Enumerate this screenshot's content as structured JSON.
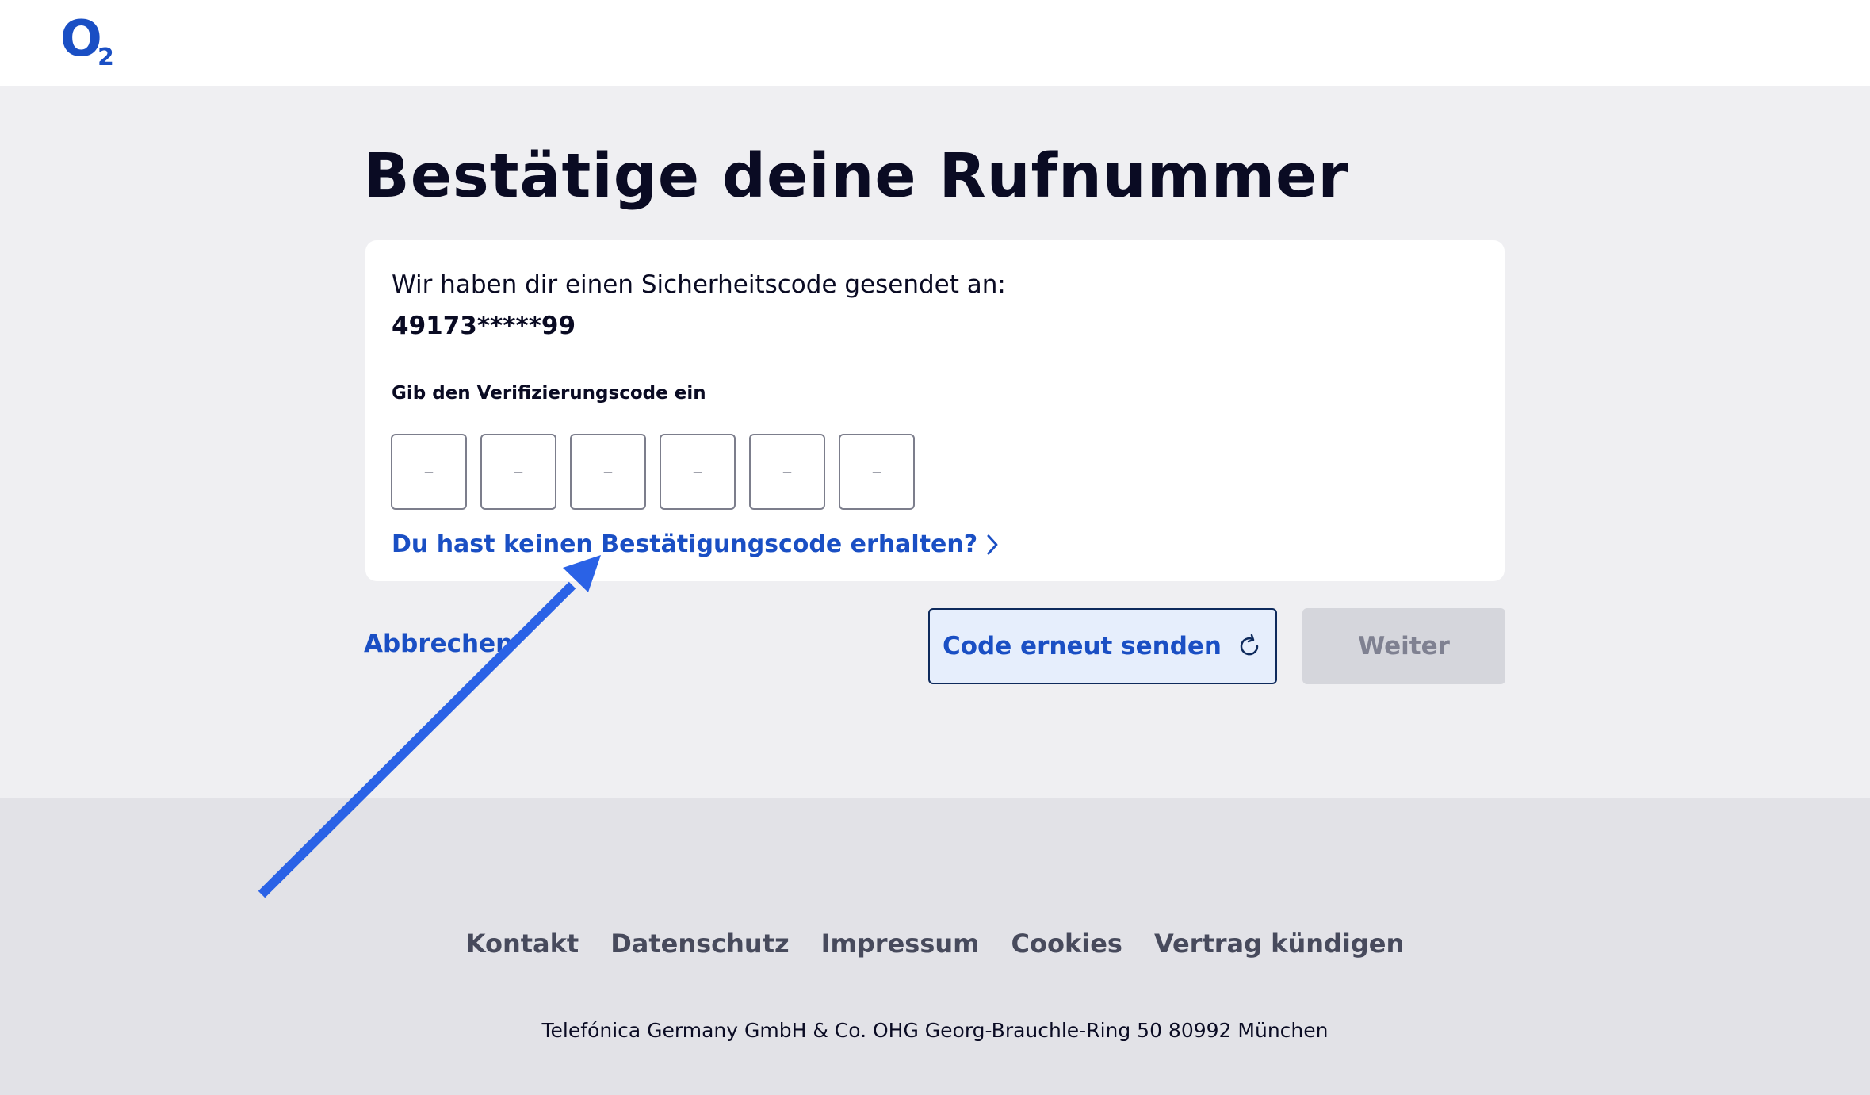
{
  "header": {
    "logo_text": "O",
    "logo_sub": "2"
  },
  "main": {
    "title": "Bestätige deine Rufnummer",
    "card": {
      "sent_text": "Wir haben dir einen Sicherheitscode gesendet an:",
      "phone_number": "49173*****99",
      "code_label": "Gib den Verifizierungscode ein",
      "code_placeholder": "–",
      "code_fields": [
        "",
        "",
        "",
        "",
        "",
        ""
      ],
      "no_code_link": "Du hast keinen Bestätigungscode erhalten?"
    },
    "cancel_label": "Abbrechen",
    "resend_label": "Code erneut senden",
    "next_label": "Weiter"
  },
  "footer": {
    "links": [
      "Kontakt",
      "Datenschutz",
      "Impressum",
      "Cookies",
      "Vertrag kündigen"
    ],
    "address": "Telefónica Germany GmbH & Co. OHG Georg-Brauchle-Ring 50 80992 München"
  },
  "colors": {
    "accent": "#1a4fc4",
    "annotation_arrow": "#2a62e6"
  },
  "icons": {
    "link_chevron": "chevron-right-icon",
    "resend": "refresh-icon"
  }
}
